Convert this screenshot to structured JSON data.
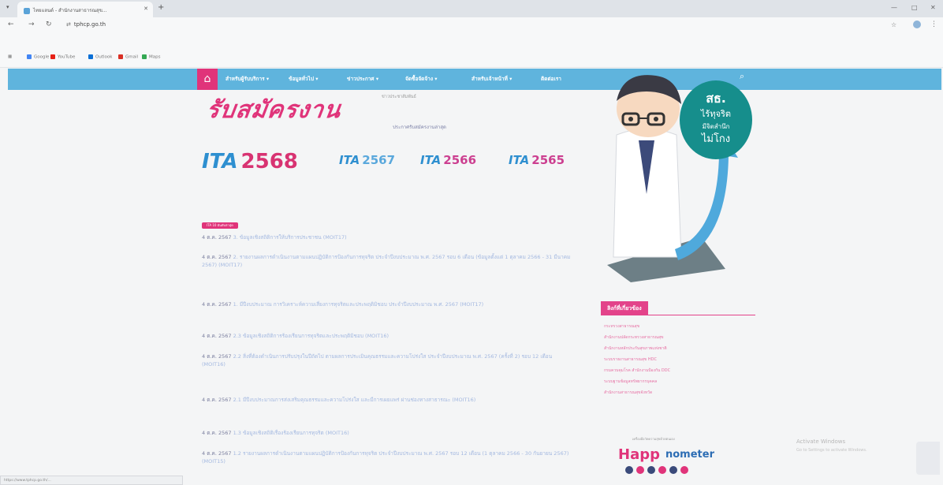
{
  "browser": {
    "tab_title": "ไทยแลนด์ - สำนักงานสาธารณสุข...",
    "new_tab": "+",
    "url": "tphcp.go.th",
    "bookmarks": [
      "Google",
      "YouTube",
      "Outlook",
      "Gmail",
      "Maps"
    ],
    "status_url": "https://www.tphcp.go.th/..."
  },
  "nav": {
    "items": [
      "สำหรับผู้รับบริการ ▾",
      "ข้อมูลทั่วไป ▾",
      "ข่าวประกาศ ▾",
      "จัดซื้อจัดจ้าง ▾",
      "สำหรับเจ้าหน้าที่ ▾",
      "ติดต่อเรา"
    ]
  },
  "banner": {
    "title": "รับสมัครงาน",
    "sub1": "ข่าวประชาสัมพันธ์",
    "sub2": "ประกาศรับสมัครงานล่าสุด"
  },
  "ita": [
    {
      "logo": "ITA",
      "year": "2568"
    },
    {
      "logo": "ITA",
      "year": "2567"
    },
    {
      "logo": "ITA",
      "year": "2566"
    },
    {
      "logo": "ITA",
      "year": "2565"
    }
  ],
  "tag": "ITA 10 อันดับล่าสุด",
  "posts": [
    {
      "date": "4 ต.ค. 2567",
      "text": "3. ข้อมูลเชิงสถิติการให้บริการประชาชน (MOIT17)"
    },
    {
      "date": "4 ต.ค. 2567",
      "text": "2. รายงานผลการดำเนินงานตามแผนปฏิบัติการป้องกันการทุจริต ประจำปีงบประมาณ พ.ศ. 2567 รอบ 6 เดือน (ข้อมูลตั้งแต่ 1 ตุลาคม 2566 - 31 มีนาคม 2567) (MOIT17)"
    },
    {
      "date": "4 ต.ค. 2567",
      "text": "1. มีปีงบประมาณ การวิเคราะห์ความเสี่ยงการทุจริตและประพฤติมิชอบ ประจำปีงบประมาณ พ.ศ. 2567 (MOIT17)"
    },
    {
      "date": "4 ต.ค. 2567",
      "text": "2.3 ข้อมูลเชิงสถิติการร้องเรียนการทุจริตและประพฤติมิชอบ (MOIT16)"
    },
    {
      "date": "4 ต.ค. 2567",
      "text": "2.2 สิ่งที่ต้องดำเนินการปรับปรุงในปีถัดไป ตามผลการประเมินคุณธรรมและความโปร่งใส ประจำปีงบประมาณ พ.ศ. 2567 (ครั้งที่ 2) รอบ 12 เดือน (MOIT16)"
    },
    {
      "date": "4 ต.ค. 2567",
      "text": "2.1 มีปีงบประมาณการส่งเสริมคุณธรรมและความโปร่งใส และมีการเผยแพร่ ผ่านช่องทางสาธารณะ (MOIT16)"
    },
    {
      "date": "4 ต.ค. 2567",
      "text": "1.3 ข้อมูลเชิงสถิติเรื่องร้องเรียนการทุจริต (MOIT16)"
    },
    {
      "date": "4 ต.ค. 2567",
      "text": "1.2 รายงานผลการดำเนินงานตามแผนปฏิบัติการป้องกันการทุจริต ประจำปีงบประมาณ พ.ศ. 2567 รอบ 12 เดือน (1 ตุลาคม 2566 - 30 กันยายน 2567) (MOIT15)"
    }
  ],
  "mascot": {
    "bubble": [
      "สธ.",
      "ไร้ทุจริต",
      "มีจิตสำนึก",
      "ไม่โกง"
    ]
  },
  "related": {
    "title": "ลิงก์ที่เกี่ยวข้อง",
    "links": [
      "กระทรวงสาธารณสุข",
      "สำนักงานปลัดกระทรวงสาธารณสุข",
      "สำนักงานหลักประกันสุขภาพแห่งชาติ",
      "ระบบรายงานสาธารณสุข HDC",
      "กรมควบคุมโรค สำนักงานป้องกัน DDC",
      "ระบบฐานข้อมูลทรัพยากรบุคคล",
      "สำนักงานสาธารณสุขจังหวัด"
    ]
  },
  "happinometer": {
    "label1": "Happ",
    "label2": "nometer",
    "tag": "เครื่องมือวัดความสุขด้วยตนเอง"
  },
  "windows": {
    "line1": "Activate Windows",
    "line2": "Go to Settings to activate Windows."
  },
  "colors": {
    "nav": "#5fb4dd",
    "accent": "#e0347a",
    "link": "#8a8fb3"
  }
}
